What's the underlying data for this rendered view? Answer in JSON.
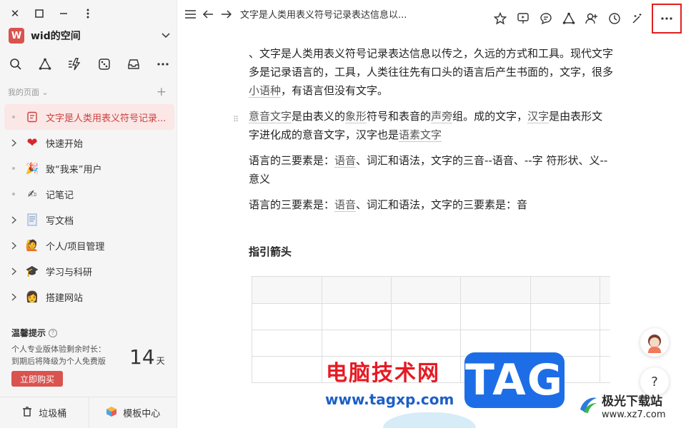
{
  "window": {
    "controls": [
      "close-icon",
      "maximize-icon",
      "minimize-icon",
      "menu-vertical-icon"
    ]
  },
  "sidebar": {
    "space_avatar": "W",
    "space_name": "wid的空间",
    "tools": [
      "search-icon",
      "graph-icon",
      "flash-icon",
      "dice-icon",
      "inbox-icon",
      "more-icon"
    ],
    "section_label": "我的页面",
    "items": [
      {
        "label": "文字是人类用表义符号记录...",
        "lead": "dot",
        "icon": "doc-icon",
        "active": true
      },
      {
        "label": "快速开始",
        "lead": "arrow",
        "icon": "heart-icon",
        "active": false
      },
      {
        "label": "致“我来”用户",
        "lead": "dot",
        "icon": "party-icon",
        "active": false
      },
      {
        "label": "记笔记",
        "lead": "dot",
        "icon": "writing-hand-icon",
        "active": false
      },
      {
        "label": "写文档",
        "lead": "arrow",
        "icon": "document-icon",
        "active": false
      },
      {
        "label": "个人/项目管理",
        "lead": "arrow",
        "icon": "person-icon",
        "active": false
      },
      {
        "label": "学习与科研",
        "lead": "arrow",
        "icon": "graduation-cap-icon",
        "active": false
      },
      {
        "label": "搭建网站",
        "lead": "arrow",
        "icon": "person-desk-icon",
        "active": false
      }
    ],
    "tip": {
      "title": "温馨提示",
      "line1": "个人专业版体验剩余时长：",
      "line2": "到期后将降级为个人免费版",
      "days": "14",
      "days_unit": "天",
      "buy_label": "立即购买"
    },
    "bottom": {
      "trash_label": "垃圾桶",
      "templates_label": "模板中心"
    }
  },
  "topbar": {
    "doc_title": "文字是人类用表义符号记录表达信息以...",
    "right_icons": [
      "star-icon",
      "present-icon",
      "comment-icon",
      "graph-icon",
      "add-user-icon",
      "history-icon",
      "ai-magic-icon",
      "more-horizontal-icon"
    ]
  },
  "content": {
    "p1_a": "、文字是人类用表义符号记录表达信息以传之，久远的方式和工具。现代文字多是记录语言的，工具，人类往往先有口头的语言后产生书面的，文字，很多",
    "p1_link": "小语种",
    "p1_b": "，有语言但没有文字。",
    "p2_link1": "意音文字",
    "p2_a": "是由表义的",
    "p2_link2": "象形",
    "p2_b": "符号和表音的",
    "p2_link3": "声旁",
    "p2_c": "组。成的文字，",
    "p2_link4": "汉字",
    "p2_d": "是由表形文字进化成的意音文字，汉字也是",
    "p2_link5": "语素文字",
    "p3_a": "语言的三要素是：",
    "p3_link": "语音",
    "p3_b": "、词汇和语法，文字的三音--语音、--字 符形状、义--意义",
    "p4_a": "语言的三要素是：",
    "p4_link": "语音",
    "p4_b": "、词汇和语法，文字的三要素是：音",
    "heading": "指引箭头"
  },
  "float": {
    "help_label": "?"
  },
  "watermark": {
    "site_cn": "电脑技术网",
    "url": "www.tagxp.com",
    "tag": "TAG",
    "logo_cn": "极光下载站",
    "logo_url": "www.xz7.com"
  },
  "colors": {
    "accent": "#d9534f",
    "highlight_box": "#e02020",
    "active_bg": "#fbe7e6"
  }
}
